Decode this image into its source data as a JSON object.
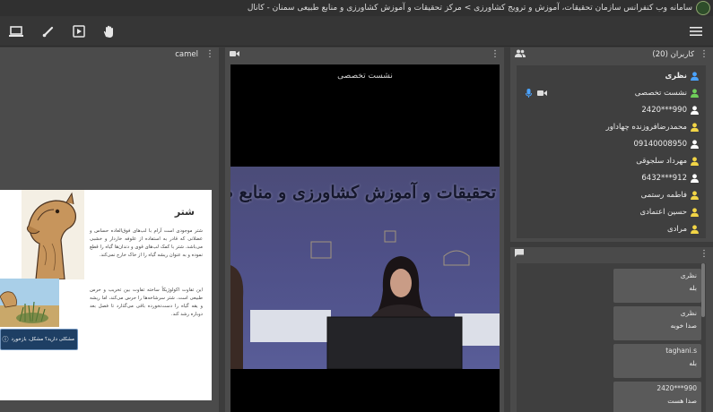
{
  "window": {
    "title": "سامانه وب کنفرانس سازمان تحقیقات، آموزش و ترویج کشاورزی > مرکز تحقیقات و آموزش کشاورزی و منابع طبیعی سمنان - کانال"
  },
  "toolbar": {
    "icons": [
      "screen-share-icon",
      "draw-icon",
      "media-play-icon",
      "raise-hand-icon",
      "menu-icon"
    ]
  },
  "presentation": {
    "file_name": "camel",
    "slide": {
      "heading": "شتر",
      "paragraph1": "شتر موجودی است آرام با لب‌های فوق‌العاده حساس و عضلانی که قادر به استفاده از علوفه خاردار و خشبی می‌باشد. شتر با کمک لب‌های قوی و دندان‌ها گیاه را قطع نموده و به عنوان ریشه گیاه را از خاک خارج نمی‌کند.",
      "paragraph2": "این تفاوت اکولوژیکاً ساخته تفاوت بین تخریب و حرس طبیعی است. شتر سرشاخه‌ها را حرس می‌کند، اما ریشه و یقه گیاه را دست‌نخورده باقی می‌گذارد تا فصل بعد دوباره رشد کند.",
      "toast": "مشکلی دارید؟ مشکل، بازخورد"
    }
  },
  "video": {
    "session_label": "نشست تخصصی",
    "banner_text": "تحقیقات و آموزش کشاورزی و منابع طبیعی استان سمنان"
  },
  "users": {
    "header": "کاربران (20)",
    "list": [
      {
        "name": "نظری",
        "color": "#4aa3ff",
        "bold": true
      },
      {
        "name": "نشست تخصصی",
        "color": "#6fcf5a",
        "bold": false
      },
      {
        "name": "990***2420",
        "color": "#ffffff",
        "bold": false
      },
      {
        "name": "محمدرضافروزنده چهاداور",
        "color": "#f2d546",
        "bold": false
      },
      {
        "name": "09140008950",
        "color": "#ffffff",
        "bold": false
      },
      {
        "name": "مهرداد سلجوقی",
        "color": "#f2d546",
        "bold": false
      },
      {
        "name": "912***6432",
        "color": "#ffffff",
        "bold": false
      },
      {
        "name": "فاطمه رستمی",
        "color": "#f2d546",
        "bold": false
      },
      {
        "name": "حسین اعتمادی",
        "color": "#f2d546",
        "bold": false
      },
      {
        "name": "مرادی",
        "color": "#f2d546",
        "bold": false
      }
    ]
  },
  "chat": {
    "messages": [
      {
        "author": "نظری",
        "text": "بله"
      },
      {
        "author": "نظری",
        "text": "صدا خوبه"
      },
      {
        "author": "taghani.s",
        "text": "بله"
      },
      {
        "author": "990***2420",
        "text": "صدا هست"
      }
    ]
  },
  "colors": {
    "accent_blue": "#4aa3ff",
    "moderator_green": "#6fcf5a",
    "viewer_yellow": "#f2d546"
  }
}
